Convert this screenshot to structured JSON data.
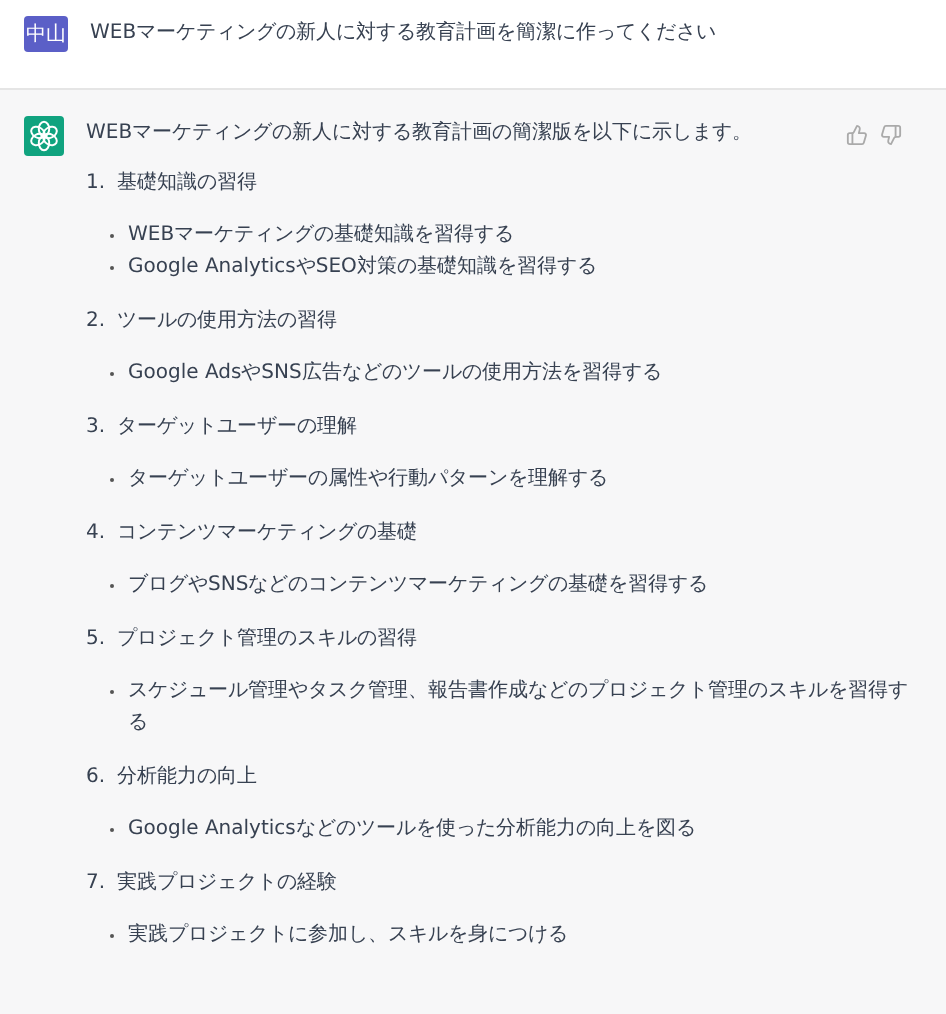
{
  "user_message": {
    "avatar": "中山",
    "text": "WEBマーケティングの新人に対する教育計画を簡潔に作ってください"
  },
  "assistant_message": {
    "intro": "WEBマーケティングの新人に対する教育計画の簡潔版を以下に示します。",
    "sections": [
      {
        "number": "1.",
        "heading": "基礎知識の習得",
        "bullets": [
          "WEBマーケティングの基礎知識を習得する",
          "Google AnalyticsやSEO対策の基礎知識を習得する"
        ]
      },
      {
        "number": "2.",
        "heading": "ツールの使用方法の習得",
        "bullets": [
          "Google AdsやSNS広告などのツールの使用方法を習得する"
        ]
      },
      {
        "number": "3.",
        "heading": "ターゲットユーザーの理解",
        "bullets": [
          "ターゲットユーザーの属性や行動パターンを理解する"
        ]
      },
      {
        "number": "4.",
        "heading": "コンテンツマーケティングの基礎",
        "bullets": [
          "ブログやSNSなどのコンテンツマーケティングの基礎を習得する"
        ]
      },
      {
        "number": "5.",
        "heading": "プロジェクト管理のスキルの習得",
        "bullets": [
          "スケジュール管理やタスク管理、報告書作成などのプロジェクト管理のスキルを習得する"
        ]
      },
      {
        "number": "6.",
        "heading": "分析能力の向上",
        "bullets": [
          "Google Analyticsなどのツールを使った分析能力の向上を図る"
        ]
      },
      {
        "number": "7.",
        "heading": "実践プロジェクトの経験",
        "bullets": [
          "実践プロジェクトに参加し、スキルを身につける"
        ]
      }
    ]
  }
}
